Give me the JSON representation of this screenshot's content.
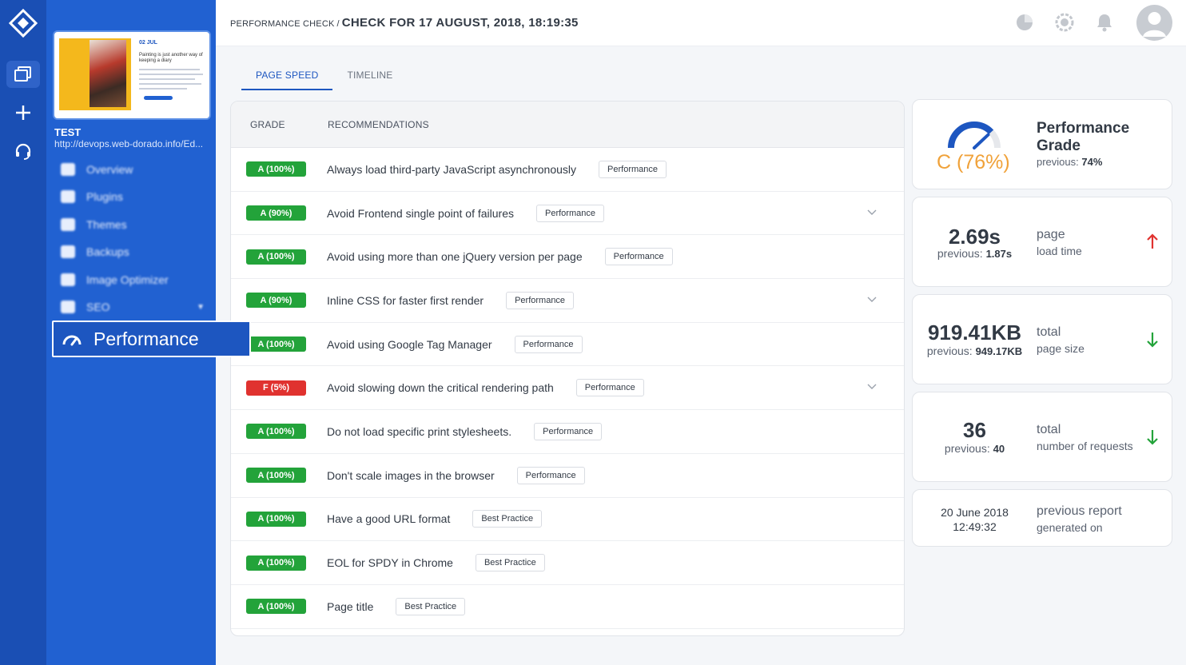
{
  "sidebar": {
    "site_name": "TEST",
    "site_url": "http://devops.web-dorado.info/Ed...",
    "thumb": {
      "date": "02 JUL",
      "headline": "Painting is just another way of keeping a diary"
    },
    "items": [
      {
        "label": "Overview"
      },
      {
        "label": "Plugins"
      },
      {
        "label": "Themes"
      },
      {
        "label": "Backups"
      },
      {
        "label": "Image Optimizer"
      },
      {
        "label": "SEO"
      }
    ],
    "active_item": "Performance"
  },
  "header": {
    "crumb_parent": "PERFORMANCE CHECK",
    "crumb_sep": "/",
    "crumb_current": "CHECK FOR 17 AUGUST, 2018, 18:19:35"
  },
  "tabs": [
    {
      "label": "PAGE SPEED"
    },
    {
      "label": "TIMELINE"
    }
  ],
  "table": {
    "col_grade": "GRADE",
    "col_recommendations": "RECOMMENDATIONS",
    "rows": [
      {
        "grade": "A (100%)",
        "text": "Always load third-party JavaScript asynchronously",
        "tag": "Performance"
      },
      {
        "grade": "A (90%)",
        "text": "Avoid Frontend single point of failures",
        "tag": "Performance"
      },
      {
        "grade": "A (100%)",
        "text": "Avoid using more than one jQuery version per page",
        "tag": "Performance"
      },
      {
        "grade": "A (90%)",
        "text": "Inline CSS for faster first render",
        "tag": "Performance"
      },
      {
        "grade": "A (100%)",
        "text": "Avoid using Google Tag Manager",
        "tag": "Performance"
      },
      {
        "grade": "F (5%)",
        "text": "Avoid slowing down the critical rendering path",
        "tag": "Performance"
      },
      {
        "grade": "A (100%)",
        "text": "Do not load specific print stylesheets.",
        "tag": "Performance"
      },
      {
        "grade": "A (100%)",
        "text": "Don't scale images in the browser",
        "tag": "Performance"
      },
      {
        "grade": "A (100%)",
        "text": "Have a good URL format",
        "tag": "Best Practice"
      },
      {
        "grade": "A (100%)",
        "text": "EOL for SPDY in Chrome",
        "tag": "Best Practice"
      },
      {
        "grade": "A (100%)",
        "text": "Page title",
        "tag": "Best Practice"
      }
    ]
  },
  "stats": {
    "grade": {
      "value": "C (76%)",
      "title_line1": "Performance",
      "title_line2": "Grade",
      "prev_label": "previous:",
      "prev_value": "74%",
      "gauge_level": 0.76
    },
    "load_time": {
      "value": "2.69s",
      "prev_label": "previous:",
      "prev_value": "1.87s",
      "label1": "page",
      "label2": "load time"
    },
    "page_size": {
      "value": "919.41KB",
      "prev_label": "previous:",
      "prev_value": "949.17KB",
      "label1": "total",
      "label2": "page size"
    },
    "requests": {
      "value": "36",
      "prev_label": "previous:",
      "prev_value": "40",
      "label1": "total",
      "label2": "number of requests"
    },
    "previous_report": {
      "date": "20 June 2018",
      "time": "12:49:32",
      "label1": "previous report",
      "label2": "generated on"
    }
  },
  "colors": {
    "brand": "#2161d1",
    "good": "#23a33a",
    "bad": "#e0322f",
    "grade_c": "#f0a23a",
    "up_arrow": "#e0322f",
    "down_arrow": "#23a33a"
  }
}
